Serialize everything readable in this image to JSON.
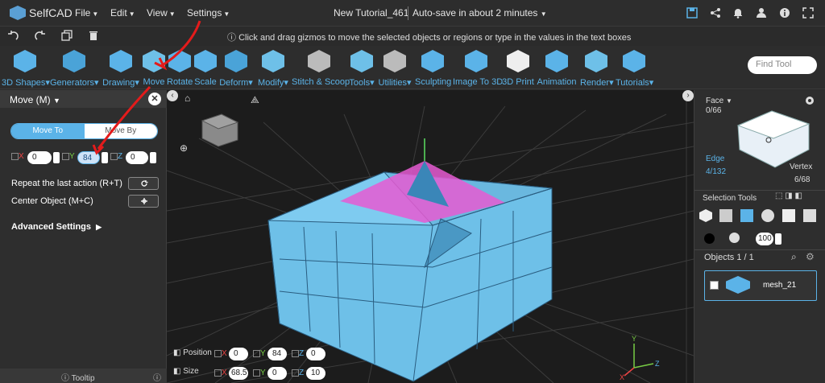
{
  "app": {
    "logo": "SelfCAD",
    "doc_title": "New Tutorial_461",
    "autosave": "Auto-save in about 2 minutes"
  },
  "menus": [
    "File",
    "Edit",
    "View",
    "Settings"
  ],
  "hint": "Click and drag gizmos to move the selected objects or regions or type in the values in the text boxes",
  "tools": [
    {
      "label": "3D Shapes",
      "caret": true,
      "icon": "cube-icon"
    },
    {
      "label": "Generators",
      "caret": true,
      "icon": "generator-icon"
    },
    {
      "label": "Drawing",
      "caret": true,
      "icon": "drawing-icon"
    },
    {
      "label": "Move",
      "caret": false,
      "icon": "move-icon"
    },
    {
      "label": "Rotate",
      "caret": false,
      "icon": "rotate-icon"
    },
    {
      "label": "Scale",
      "caret": false,
      "icon": "scale-icon"
    },
    {
      "label": "Deform",
      "caret": true,
      "icon": "deform-icon"
    },
    {
      "label": "Modify",
      "caret": true,
      "icon": "modify-icon"
    },
    {
      "label": "Stitch & Scoop",
      "caret": false,
      "icon": "stitch-icon"
    },
    {
      "label": "Tools",
      "caret": true,
      "icon": "tools-icon"
    },
    {
      "label": "Utilities",
      "caret": true,
      "icon": "utilities-icon"
    },
    {
      "label": "Sculpting",
      "caret": false,
      "icon": "sculpting-icon"
    },
    {
      "label": "Image To 3D",
      "caret": false,
      "icon": "image-to-3d-icon"
    },
    {
      "label": "3D Print",
      "caret": false,
      "icon": "print-icon"
    },
    {
      "label": "Animation",
      "caret": false,
      "icon": "animation-icon"
    },
    {
      "label": "Render",
      "caret": true,
      "icon": "render-icon"
    },
    {
      "label": "Tutorials",
      "caret": true,
      "icon": "tutorials-icon"
    }
  ],
  "find_placeholder": "Find Tool",
  "left": {
    "title": "Move (M)",
    "seg_on": "Move To",
    "seg_off": "Move By",
    "x": "0",
    "y": "84",
    "z": "0",
    "repeat": "Repeat the last action (R+T)",
    "center": "Center Object (M+C)",
    "advanced": "Advanced Settings",
    "tooltip": "Tooltip"
  },
  "right": {
    "face": "Face",
    "face_count": "0/66",
    "edge": "Edge",
    "edge_count": "4/132",
    "vertex": "Vertex",
    "vertex_count": "6/68",
    "selection_tools": "Selection Tools",
    "opacity": "100",
    "objects": "Objects 1 / 1",
    "object_name": "mesh_21"
  },
  "bottom": {
    "position_label": "Position",
    "px": "0",
    "py": "84",
    "pz": "0",
    "size_label": "Size",
    "sx": "68.5",
    "sy": "0",
    "sz": "10"
  },
  "colors": {
    "accent": "#5bb3e8",
    "mesh": "#6ec0e8",
    "highlight": "#e65bd2",
    "arrow": "#e41b1b"
  }
}
